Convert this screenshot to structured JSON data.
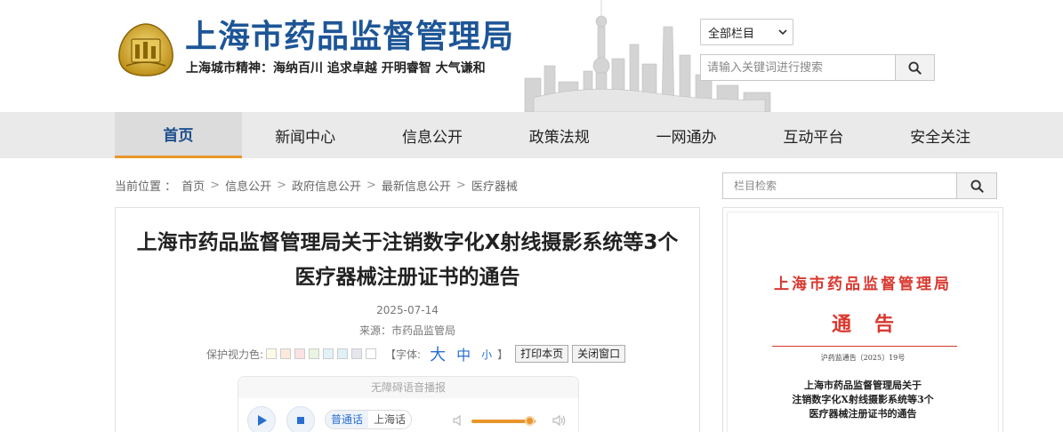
{
  "header": {
    "title": "上海市药品监督管理局",
    "slogan": "上海城市精神：海纳百川  追求卓越  开明睿智  大气谦和",
    "scope_select": "全部栏目",
    "search_placeholder": "请输入关键词进行搜索"
  },
  "nav": {
    "items": [
      {
        "label": "首页"
      },
      {
        "label": "新闻中心"
      },
      {
        "label": "信息公开"
      },
      {
        "label": "政策法规"
      },
      {
        "label": "一网通办"
      },
      {
        "label": "互动平台"
      },
      {
        "label": "安全关注"
      }
    ],
    "active_index": 0
  },
  "breadcrumb": {
    "label": "当前位置 ：",
    "items": [
      "首页",
      "信息公开",
      "政府信息公开",
      "最新信息公开",
      "医疗器械"
    ],
    "separator": ">"
  },
  "article": {
    "title_line1": "上海市药品监督管理局关于注销数字化X射线摄影系统等3个",
    "title_line2": "医疗器械注册证书的通告",
    "date": "2025-07-14",
    "source": "来源：市药品监管局"
  },
  "toolbar": {
    "vision_label": "保护视力色:",
    "swatch_colors": [
      "#fdfbe6",
      "#fde9dd",
      "#fbe3e3",
      "#e8f5e0",
      "#e2f3f8",
      "#dff0f7",
      "#e6e6ef",
      "#ffffff"
    ],
    "font_label": "【字体:",
    "font_big": "大",
    "font_mid": "中",
    "font_small": "小",
    "font_close": "】",
    "print_label": "打印本页",
    "close_label": "关闭窗口"
  },
  "audio": {
    "title": "无障碍语音播报",
    "lang_options": [
      "普通话",
      "上海话"
    ],
    "active_lang": 0,
    "volume": 0.9
  },
  "sidebar": {
    "search_placeholder": "栏目检索",
    "doc": {
      "org": "上海市药品监督管理局",
      "type": "通告",
      "number": "沪药监通告〔2025〕19号",
      "title_line1": "上海市药品监督管理局关于",
      "title_line2": "注销数字化X射线摄影系统等3个",
      "title_line3": "医疗器械注册证书的通告"
    }
  },
  "colors": {
    "brand_blue": "#1d5597",
    "accent_orange": "#e8962b",
    "doc_red": "#d9382f",
    "nav_bg": "#eaeaea"
  }
}
